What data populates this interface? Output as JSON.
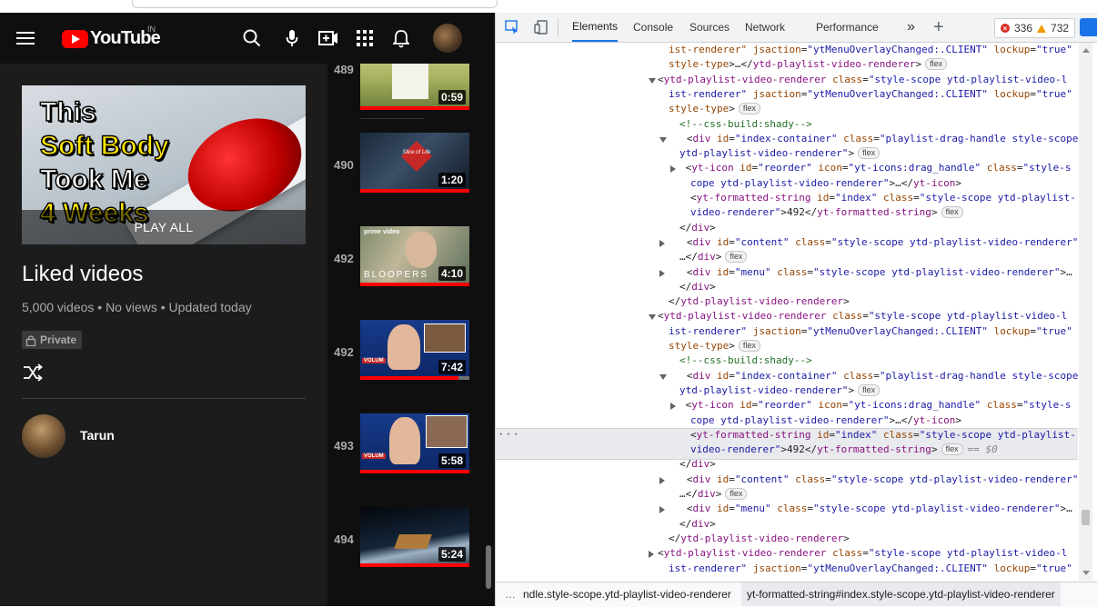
{
  "youtube": {
    "header": {
      "logo_text": "YouTube",
      "country_code": "IN"
    },
    "playlist": {
      "thumbnail_lines": [
        "This",
        "Soft Body",
        "Took Me",
        "4 Weeks"
      ],
      "play_all_label": "PLAY ALL",
      "title": "Liked videos",
      "meta": "5,000 videos • No views • Updated today",
      "privacy_label": "Private",
      "owner_name": "Tarun"
    },
    "videos": [
      {
        "index": "489",
        "duration": "0:59",
        "watched": 1.0
      },
      {
        "index": "490",
        "duration": "1:20",
        "watched": 1.0
      },
      {
        "index": "492",
        "duration": "4:10",
        "watched": 1.0
      },
      {
        "index": "492",
        "duration": "7:42",
        "watched": 0.9
      },
      {
        "index": "493",
        "duration": "5:58",
        "watched": 1.0
      },
      {
        "index": "494",
        "duration": "5:24",
        "watched": 1.0
      }
    ],
    "thumb_badges": {
      "slice_title": "Slice of Life",
      "prime": "prime video",
      "bloopers": "BLOOPERS",
      "news": "VOLUM"
    }
  },
  "devtools": {
    "tabs": [
      "Elements",
      "Console",
      "Sources",
      "Network",
      "Performance"
    ],
    "active_tab": "Elements",
    "error_count": "336",
    "warning_count": "732",
    "dom_lines": [
      {
        "indent": 0,
        "tw": "",
        "html": "<span class=\"an\">ist-renderer\"</span> <span class=\"an\">jsaction</span>=<span class=\"av\">\"ytMenuOverlayChanged:.CLIENT\"</span> <span class=\"an\">lockup</span>=<span class=\"av\">\"true\"</span>"
      },
      {
        "indent": 0,
        "tw": "",
        "html": "<span class=\"an\">style-type</span>&gt;…&lt;/<span class=\"tg\">ytd-playlist-video-renderer</span>&gt;<span class=\"badge\">flex</span>"
      },
      {
        "indent": -1,
        "tw": "down",
        "html": "&lt;<span class=\"tg\">ytd-playlist-video-renderer</span> <span class=\"an\">class</span>=<span class=\"av\">\"style-scope ytd-playlist-video-l</span>"
      },
      {
        "indent": 0,
        "tw": "",
        "html": "<span class=\"av\">ist-renderer\"</span> <span class=\"an\">jsaction</span>=<span class=\"av\">\"ytMenuOverlayChanged:.CLIENT\"</span> <span class=\"an\">lockup</span>=<span class=\"av\">\"true\"</span>"
      },
      {
        "indent": 0,
        "tw": "",
        "html": "<span class=\"an\">style-type</span>&gt;<span class=\"badge\">flex</span>"
      },
      {
        "indent": 1,
        "tw": "",
        "html": "<span class=\"cm\">&lt;!--css-build:shady--&gt;</span>"
      },
      {
        "indent": 0,
        "tw": "down",
        "html": "   &lt;<span class=\"tg\">div</span> <span class=\"an\">id</span>=<span class=\"av\">\"index-container\"</span> <span class=\"an\">class</span>=<span class=\"av\">\"playlist-drag-handle style-scope</span>"
      },
      {
        "indent": 1,
        "tw": "",
        "html": "<span class=\"av\">ytd-playlist-video-renderer\"</span>&gt;<span class=\"badge\">flex</span>"
      },
      {
        "indent": 1,
        "tw": "right",
        "html": " &lt;<span class=\"tg\">yt-icon</span> <span class=\"an\">id</span>=<span class=\"av\">\"reorder\"</span> <span class=\"an\">icon</span>=<span class=\"av\">\"yt-icons:drag_handle\"</span> <span class=\"an\">class</span>=<span class=\"av\">\"style-s</span>"
      },
      {
        "indent": 2,
        "tw": "",
        "html": "<span class=\"av\">cope ytd-playlist-video-renderer\"</span>&gt;…&lt;/<span class=\"tg\">yt-icon</span>&gt;"
      },
      {
        "indent": 2,
        "tw": "",
        "html": "&lt;<span class=\"tg\">yt-formatted-string</span> <span class=\"an\">id</span>=<span class=\"av\">\"index\"</span> <span class=\"an\">class</span>=<span class=\"av\">\"style-scope ytd-playlist-</span>"
      },
      {
        "indent": 2,
        "tw": "",
        "html": "<span class=\"av\">video-renderer\"</span>&gt;492&lt;/<span class=\"tg\">yt-formatted-string</span>&gt;<span class=\"badge\">flex</span>"
      },
      {
        "indent": 1,
        "tw": "",
        "html": "&lt;/<span class=\"tg\">div</span>&gt;"
      },
      {
        "indent": 0,
        "tw": "right",
        "html": "   &lt;<span class=\"tg\">div</span> <span class=\"an\">id</span>=<span class=\"av\">\"content\"</span> <span class=\"an\">class</span>=<span class=\"av\">\"style-scope ytd-playlist-video-renderer\"</span>&gt;"
      },
      {
        "indent": 1,
        "tw": "",
        "html": "…&lt;/<span class=\"tg\">div</span>&gt;<span class=\"badge\">flex</span>"
      },
      {
        "indent": 0,
        "tw": "right",
        "html": "   &lt;<span class=\"tg\">div</span> <span class=\"an\">id</span>=<span class=\"av\">\"menu\"</span> <span class=\"an\">class</span>=<span class=\"av\">\"style-scope ytd-playlist-video-renderer\"</span>&gt;…"
      },
      {
        "indent": 1,
        "tw": "",
        "html": "&lt;/<span class=\"tg\">div</span>&gt;"
      },
      {
        "indent": 0,
        "tw": "",
        "html": "&lt;/<span class=\"tg\">ytd-playlist-video-renderer</span>&gt;"
      },
      {
        "indent": -1,
        "tw": "down",
        "html": "&lt;<span class=\"tg\">ytd-playlist-video-renderer</span> <span class=\"an\">class</span>=<span class=\"av\">\"style-scope ytd-playlist-video-l</span>"
      },
      {
        "indent": 0,
        "tw": "",
        "html": "<span class=\"av\">ist-renderer\"</span> <span class=\"an\">jsaction</span>=<span class=\"av\">\"ytMenuOverlayChanged:.CLIENT\"</span> <span class=\"an\">lockup</span>=<span class=\"av\">\"true\"</span>"
      },
      {
        "indent": 0,
        "tw": "",
        "html": "<span class=\"an\">style-type</span>&gt;<span class=\"badge\">flex</span>"
      },
      {
        "indent": 1,
        "tw": "",
        "html": "<span class=\"cm\">&lt;!--css-build:shady--&gt;</span>"
      },
      {
        "indent": 0,
        "tw": "down",
        "html": "   &lt;<span class=\"tg\">div</span> <span class=\"an\">id</span>=<span class=\"av\">\"index-container\"</span> <span class=\"an\">class</span>=<span class=\"av\">\"playlist-drag-handle style-scope</span>"
      },
      {
        "indent": 1,
        "tw": "",
        "html": "<span class=\"av\">ytd-playlist-video-renderer\"</span>&gt;<span class=\"badge\">flex</span>"
      },
      {
        "indent": 1,
        "tw": "right",
        "html": " &lt;<span class=\"tg\">yt-icon</span> <span class=\"an\">id</span>=<span class=\"av\">\"reorder\"</span> <span class=\"an\">icon</span>=<span class=\"av\">\"yt-icons:drag_handle\"</span> <span class=\"an\">class</span>=<span class=\"av\">\"style-s</span>"
      },
      {
        "indent": 2,
        "tw": "",
        "html": "<span class=\"av\">cope ytd-playlist-video-renderer\"</span>&gt;…&lt;/<span class=\"tg\">yt-icon</span>&gt;"
      },
      {
        "indent": 2,
        "tw": "",
        "html": "&lt;<span class=\"tg\">yt-formatted-string</span> <span class=\"an\">id</span>=<span class=\"av\">\"index\"</span> <span class=\"an\">class</span>=<span class=\"av\">\"style-scope ytd-playlist-</span>"
      },
      {
        "indent": 2,
        "tw": "",
        "html": "<span class=\"av\">video-renderer\"</span>&gt;492&lt;/<span class=\"tg\">yt-formatted-string</span>&gt;<span class=\"badge\">flex</span><span class=\"eq0\">== $0</span>"
      },
      {
        "indent": 1,
        "tw": "",
        "html": "&lt;/<span class=\"tg\">div</span>&gt;"
      },
      {
        "indent": 0,
        "tw": "right",
        "html": "   &lt;<span class=\"tg\">div</span> <span class=\"an\">id</span>=<span class=\"av\">\"content\"</span> <span class=\"an\">class</span>=<span class=\"av\">\"style-scope ytd-playlist-video-renderer\"</span>&gt;"
      },
      {
        "indent": 1,
        "tw": "",
        "html": "…&lt;/<span class=\"tg\">div</span>&gt;<span class=\"badge\">flex</span>"
      },
      {
        "indent": 0,
        "tw": "right",
        "html": "   &lt;<span class=\"tg\">div</span> <span class=\"an\">id</span>=<span class=\"av\">\"menu\"</span> <span class=\"an\">class</span>=<span class=\"av\">\"style-scope ytd-playlist-video-renderer\"</span>&gt;…"
      },
      {
        "indent": 1,
        "tw": "",
        "html": "&lt;/<span class=\"tg\">div</span>&gt;"
      },
      {
        "indent": 0,
        "tw": "",
        "html": "&lt;/<span class=\"tg\">ytd-playlist-video-renderer</span>&gt;"
      },
      {
        "indent": -1,
        "tw": "right",
        "html": "&lt;<span class=\"tg\">ytd-playlist-video-renderer</span> <span class=\"an\">class</span>=<span class=\"av\">\"style-scope ytd-playlist-video-l</span>"
      },
      {
        "indent": 0,
        "tw": "",
        "html": "<span class=\"av\">ist-renderer\"</span> <span class=\"an\">jsaction</span>=<span class=\"av\">\"ytMenuOverlayChanged:.CLIENT\"</span> <span class=\"an\">lockup</span>=<span class=\"av\">\"true\"</span>"
      }
    ],
    "selected_line": 27,
    "breadcrumbs": [
      "ndle.style-scope.ytd-playlist-video-renderer",
      "yt-formatted-string#index.style-scope.ytd-playlist-video-renderer"
    ],
    "breadcrumb_ellipsis": "…"
  }
}
